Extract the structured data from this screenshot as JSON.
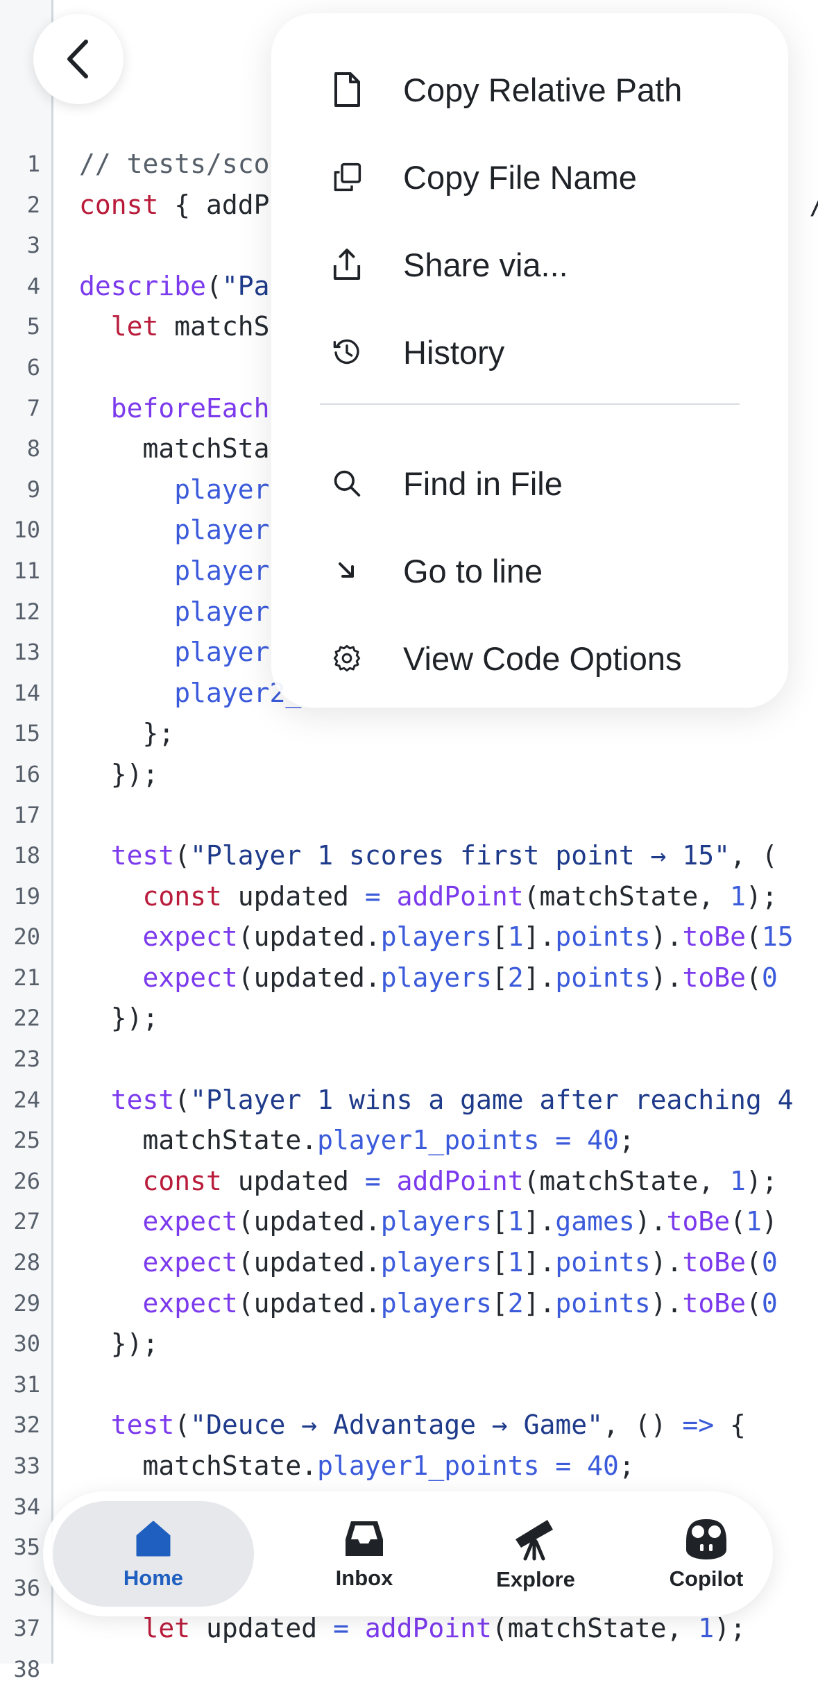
{
  "colors": {
    "keyword": "#b91c3b",
    "function": "#7c3aed",
    "string": "#1e3a8a",
    "property": "#3b5bdb",
    "accent": "#1f5fbf"
  },
  "header": {
    "back_icon": "chevron-left-icon"
  },
  "menu": {
    "items": [
      {
        "label": "Copy Relative Path",
        "icon": "file-icon"
      },
      {
        "label": "Copy File Name",
        "icon": "copy-icon"
      },
      {
        "label": "Share via...",
        "icon": "share-icon"
      },
      {
        "label": "History",
        "icon": "history-icon"
      },
      {
        "label": "Find in File",
        "icon": "search-icon"
      },
      {
        "label": "Go to line",
        "icon": "arrow-down-right-icon"
      },
      {
        "label": "View Code Options",
        "icon": "gear-icon"
      }
    ]
  },
  "code": {
    "lines": [
      {
        "n": "1",
        "tokens": [
          [
            "cm",
            "// tests/sco"
          ]
        ]
      },
      {
        "n": "2",
        "tokens": [
          [
            "kw",
            "const"
          ],
          [
            "pl",
            " { addP"
          ],
          [
            "pl",
            "                                  "
          ],
          [
            "pl",
            "/s"
          ]
        ]
      },
      {
        "n": "3",
        "tokens": []
      },
      {
        "n": "4",
        "tokens": [
          [
            "fn",
            "describe"
          ],
          [
            "pl",
            "("
          ],
          [
            "str",
            "\"Pa"
          ]
        ]
      },
      {
        "n": "5",
        "tokens": [
          [
            "pl",
            "  "
          ],
          [
            "kw",
            "let"
          ],
          [
            "pl",
            " matchS"
          ]
        ]
      },
      {
        "n": "6",
        "tokens": []
      },
      {
        "n": "7",
        "tokens": [
          [
            "pl",
            "  "
          ],
          [
            "fn",
            "beforeEach"
          ]
        ]
      },
      {
        "n": "8",
        "tokens": [
          [
            "pl",
            "    matchSta"
          ]
        ]
      },
      {
        "n": "9",
        "tokens": [
          [
            "pl",
            "      "
          ],
          [
            "prop",
            "player"
          ]
        ]
      },
      {
        "n": "10",
        "tokens": [
          [
            "pl",
            "      "
          ],
          [
            "prop",
            "player"
          ]
        ]
      },
      {
        "n": "11",
        "tokens": [
          [
            "pl",
            "      "
          ],
          [
            "prop",
            "player"
          ]
        ]
      },
      {
        "n": "12",
        "tokens": [
          [
            "pl",
            "      "
          ],
          [
            "prop",
            "player"
          ]
        ]
      },
      {
        "n": "13",
        "tokens": [
          [
            "pl",
            "      "
          ],
          [
            "prop",
            "player"
          ]
        ]
      },
      {
        "n": "14",
        "tokens": [
          [
            "pl",
            "      "
          ],
          [
            "prop",
            "player2_"
          ]
        ]
      },
      {
        "n": "15",
        "tokens": [
          [
            "pl",
            "    };"
          ]
        ]
      },
      {
        "n": "16",
        "tokens": [
          [
            "pl",
            "  });"
          ]
        ]
      },
      {
        "n": "17",
        "tokens": []
      },
      {
        "n": "18",
        "tokens": [
          [
            "pl",
            "  "
          ],
          [
            "fn",
            "test"
          ],
          [
            "pl",
            "("
          ],
          [
            "str",
            "\"Player 1 scores first point → 15\""
          ],
          [
            "pl",
            ", ("
          ]
        ]
      },
      {
        "n": "19",
        "tokens": [
          [
            "pl",
            "    "
          ],
          [
            "kw",
            "const"
          ],
          [
            "pl",
            " updated "
          ],
          [
            "op",
            "="
          ],
          [
            "pl",
            " "
          ],
          [
            "fn",
            "addPoint"
          ],
          [
            "pl",
            "(matchState, "
          ],
          [
            "num",
            "1"
          ],
          [
            "pl",
            ");"
          ]
        ]
      },
      {
        "n": "20",
        "tokens": [
          [
            "pl",
            "    "
          ],
          [
            "fn",
            "expect"
          ],
          [
            "pl",
            "(updated."
          ],
          [
            "prop",
            "players"
          ],
          [
            "pl",
            "["
          ],
          [
            "num",
            "1"
          ],
          [
            "pl",
            "]."
          ],
          [
            "prop",
            "points"
          ],
          [
            "pl",
            ")."
          ],
          [
            "fn",
            "toBe"
          ],
          [
            "pl",
            "("
          ],
          [
            "num",
            "15"
          ]
        ]
      },
      {
        "n": "21",
        "tokens": [
          [
            "pl",
            "    "
          ],
          [
            "fn",
            "expect"
          ],
          [
            "pl",
            "(updated."
          ],
          [
            "prop",
            "players"
          ],
          [
            "pl",
            "["
          ],
          [
            "num",
            "2"
          ],
          [
            "pl",
            "]."
          ],
          [
            "prop",
            "points"
          ],
          [
            "pl",
            ")."
          ],
          [
            "fn",
            "toBe"
          ],
          [
            "pl",
            "("
          ],
          [
            "num",
            "0"
          ]
        ]
      },
      {
        "n": "22",
        "tokens": [
          [
            "pl",
            "  });"
          ]
        ]
      },
      {
        "n": "23",
        "tokens": []
      },
      {
        "n": "24",
        "tokens": [
          [
            "pl",
            "  "
          ],
          [
            "fn",
            "test"
          ],
          [
            "pl",
            "("
          ],
          [
            "str",
            "\"Player 1 wins a game after reaching 4"
          ]
        ]
      },
      {
        "n": "25",
        "tokens": [
          [
            "pl",
            "    matchState."
          ],
          [
            "prop",
            "player1_points"
          ],
          [
            "pl",
            " "
          ],
          [
            "op",
            "="
          ],
          [
            "pl",
            " "
          ],
          [
            "num",
            "40"
          ],
          [
            "pl",
            ";"
          ]
        ]
      },
      {
        "n": "26",
        "tokens": [
          [
            "pl",
            "    "
          ],
          [
            "kw",
            "const"
          ],
          [
            "pl",
            " updated "
          ],
          [
            "op",
            "="
          ],
          [
            "pl",
            " "
          ],
          [
            "fn",
            "addPoint"
          ],
          [
            "pl",
            "(matchState, "
          ],
          [
            "num",
            "1"
          ],
          [
            "pl",
            ");"
          ]
        ]
      },
      {
        "n": "27",
        "tokens": [
          [
            "pl",
            "    "
          ],
          [
            "fn",
            "expect"
          ],
          [
            "pl",
            "(updated."
          ],
          [
            "prop",
            "players"
          ],
          [
            "pl",
            "["
          ],
          [
            "num",
            "1"
          ],
          [
            "pl",
            "]."
          ],
          [
            "prop",
            "games"
          ],
          [
            "pl",
            ")."
          ],
          [
            "fn",
            "toBe"
          ],
          [
            "pl",
            "("
          ],
          [
            "num",
            "1"
          ],
          [
            "pl",
            ")"
          ]
        ]
      },
      {
        "n": "28",
        "tokens": [
          [
            "pl",
            "    "
          ],
          [
            "fn",
            "expect"
          ],
          [
            "pl",
            "(updated."
          ],
          [
            "prop",
            "players"
          ],
          [
            "pl",
            "["
          ],
          [
            "num",
            "1"
          ],
          [
            "pl",
            "]."
          ],
          [
            "prop",
            "points"
          ],
          [
            "pl",
            ")."
          ],
          [
            "fn",
            "toBe"
          ],
          [
            "pl",
            "("
          ],
          [
            "num",
            "0"
          ]
        ]
      },
      {
        "n": "29",
        "tokens": [
          [
            "pl",
            "    "
          ],
          [
            "fn",
            "expect"
          ],
          [
            "pl",
            "(updated."
          ],
          [
            "prop",
            "players"
          ],
          [
            "pl",
            "["
          ],
          [
            "num",
            "2"
          ],
          [
            "pl",
            "]."
          ],
          [
            "prop",
            "points"
          ],
          [
            "pl",
            ")."
          ],
          [
            "fn",
            "toBe"
          ],
          [
            "pl",
            "("
          ],
          [
            "num",
            "0"
          ]
        ]
      },
      {
        "n": "30",
        "tokens": [
          [
            "pl",
            "  });"
          ]
        ]
      },
      {
        "n": "31",
        "tokens": []
      },
      {
        "n": "32",
        "tokens": [
          [
            "pl",
            "  "
          ],
          [
            "fn",
            "test"
          ],
          [
            "pl",
            "("
          ],
          [
            "str",
            "\"Deuce → Advantage → Game\""
          ],
          [
            "pl",
            ", () "
          ],
          [
            "op",
            "=>"
          ],
          [
            "pl",
            " {"
          ]
        ]
      },
      {
        "n": "33",
        "tokens": [
          [
            "pl",
            "    matchState."
          ],
          [
            "prop",
            "player1_points"
          ],
          [
            "pl",
            " "
          ],
          [
            "op",
            "="
          ],
          [
            "pl",
            " "
          ],
          [
            "num",
            "40"
          ],
          [
            "pl",
            ";"
          ]
        ]
      },
      {
        "n": "34",
        "tokens": []
      },
      {
        "n": "35",
        "tokens": []
      },
      {
        "n": "36",
        "tokens": []
      },
      {
        "n": "37",
        "tokens": [
          [
            "pl",
            "    "
          ],
          [
            "kw",
            "let"
          ],
          [
            "pl",
            " updated "
          ],
          [
            "op",
            "="
          ],
          [
            "pl",
            " "
          ],
          [
            "fn",
            "addPoint"
          ],
          [
            "pl",
            "(matchState, "
          ],
          [
            "num",
            "1"
          ],
          [
            "pl",
            ");"
          ]
        ]
      },
      {
        "n": "38",
        "tokens": []
      }
    ]
  },
  "tabbar": {
    "tabs": [
      {
        "label": "Home",
        "icon": "home-icon",
        "active": true
      },
      {
        "label": "Inbox",
        "icon": "inbox-icon",
        "active": false
      },
      {
        "label": "Explore",
        "icon": "telescope-icon",
        "active": false
      },
      {
        "label": "Copilot",
        "icon": "copilot-icon",
        "active": false
      }
    ]
  }
}
